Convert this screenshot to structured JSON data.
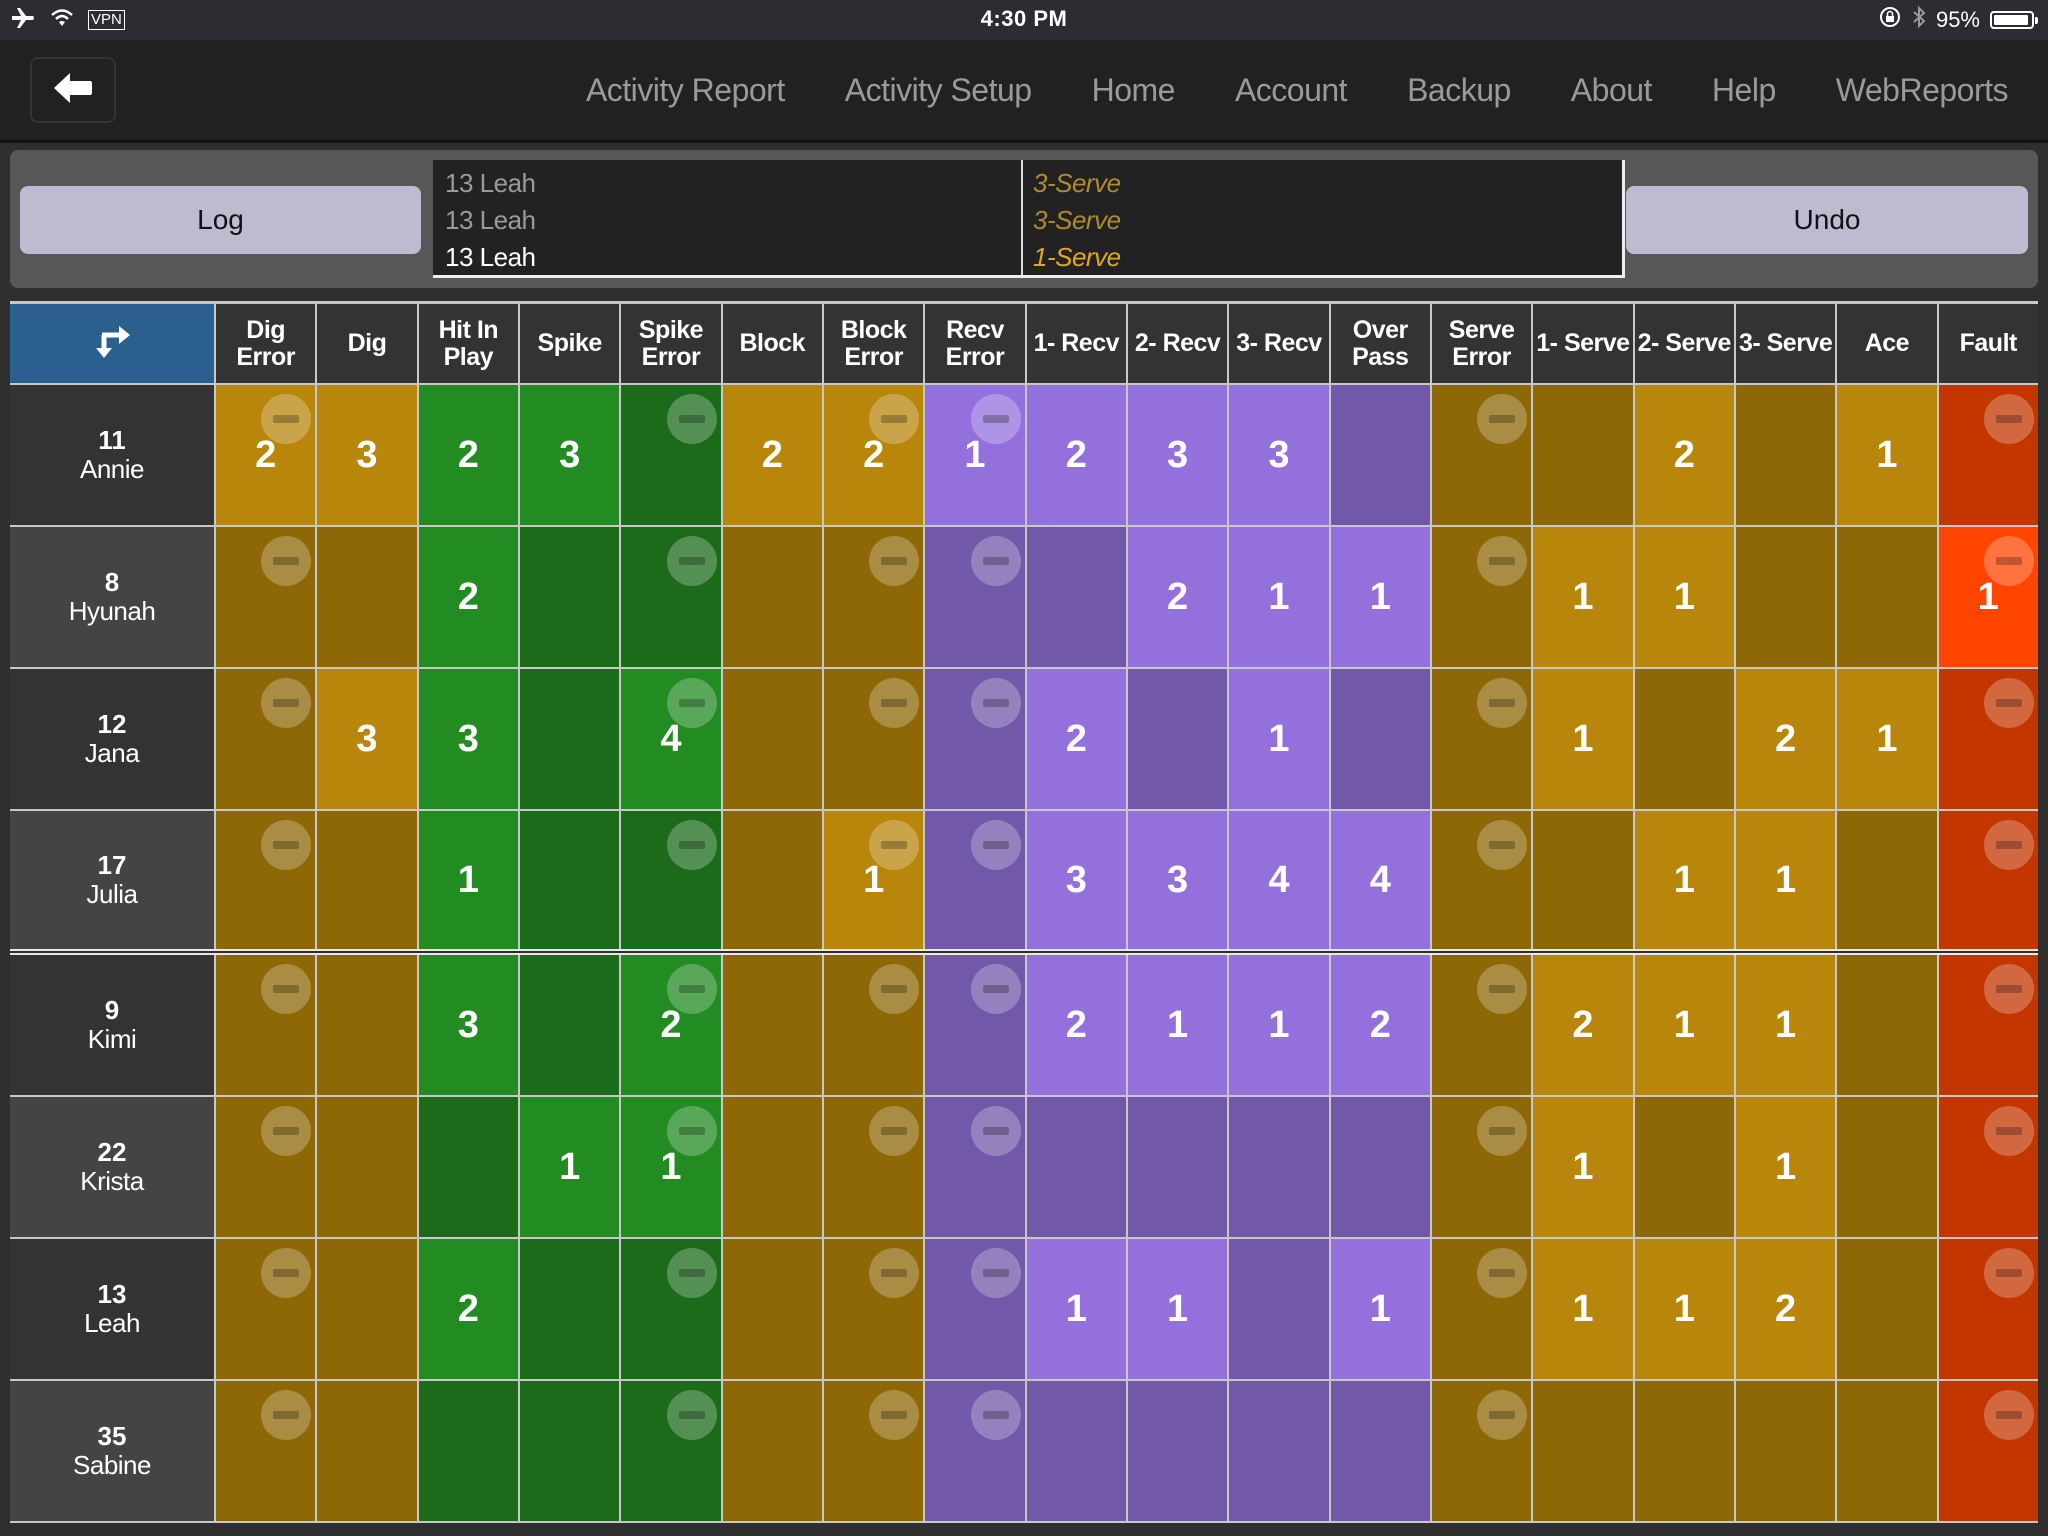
{
  "status_bar": {
    "time": "4:30 PM",
    "vpn_label": "VPN",
    "battery_percent_label": "95%",
    "battery_level": 0.95,
    "icons": [
      "airplane-icon",
      "wifi-icon",
      "vpn-icon",
      "rotation-lock-icon",
      "bluetooth-icon",
      "battery-icon"
    ]
  },
  "nav": {
    "back_icon": "arrow-left-icon",
    "items": [
      {
        "label": "Activity Report"
      },
      {
        "label": "Activity Setup"
      },
      {
        "label": "Home"
      },
      {
        "label": "Account"
      },
      {
        "label": "Backup"
      },
      {
        "label": "About"
      },
      {
        "label": "Help"
      },
      {
        "label": "WebReports"
      }
    ]
  },
  "log_panel": {
    "log_label": "Log",
    "undo_label": "Undo",
    "entries": [
      {
        "player": "13 Leah",
        "action": "3-Serve",
        "current": false
      },
      {
        "player": "13 Leah",
        "action": "3-Serve",
        "current": false
      },
      {
        "player": "13 Leah",
        "action": "1-Serve",
        "current": true
      }
    ]
  },
  "grid": {
    "corner_icon": "swap-arrows-icon",
    "columns": [
      {
        "label": "Dig Error",
        "group": "gold",
        "error": true
      },
      {
        "label": "Dig",
        "group": "gold",
        "error": false
      },
      {
        "label": "Hit In Play",
        "group": "green",
        "error": false
      },
      {
        "label": "Spike",
        "group": "green",
        "error": false
      },
      {
        "label": "Spike Error",
        "group": "green",
        "error": true
      },
      {
        "label": "Block",
        "group": "gold",
        "error": false
      },
      {
        "label": "Block Error",
        "group": "gold",
        "error": true
      },
      {
        "label": "Recv Error",
        "group": "purple",
        "error": true
      },
      {
        "label": "1- Recv",
        "group": "purple",
        "error": false
      },
      {
        "label": "2- Recv",
        "group": "purple",
        "error": false
      },
      {
        "label": "3- Recv",
        "group": "purple",
        "error": false
      },
      {
        "label": "Over Pass",
        "group": "purple",
        "error": false
      },
      {
        "label": "Serve Error",
        "group": "gold",
        "error": true
      },
      {
        "label": "1- Serve",
        "group": "gold",
        "error": false
      },
      {
        "label": "2- Serve",
        "group": "gold",
        "error": false
      },
      {
        "label": "3- Serve",
        "group": "gold",
        "error": false
      },
      {
        "label": "Ace",
        "group": "gold",
        "error": false
      },
      {
        "label": "Fault",
        "group": "red",
        "error": true
      }
    ],
    "colors": {
      "gold": {
        "active": "#b8860b",
        "dim": "#8e6706"
      },
      "green": {
        "active": "#228b22",
        "dim": "#1b6b1b"
      },
      "purple": {
        "active": "#9370db",
        "dim": "#7158a8"
      },
      "red": {
        "active": "#ff4500",
        "dim": "#c33600"
      },
      "header_corner": "#2a5f8f"
    },
    "rows": [
      {
        "number": "11",
        "name": "Annie",
        "values": [
          "2",
          "3",
          "2",
          "3",
          "",
          "2",
          "2",
          "1",
          "2",
          "3",
          "3",
          "",
          "",
          "",
          "2",
          "",
          "1",
          ""
        ]
      },
      {
        "number": "8",
        "name": "Hyunah",
        "values": [
          "",
          "",
          "2",
          "",
          "",
          "",
          "",
          "",
          "",
          "2",
          "1",
          "1",
          "",
          "1",
          "1",
          "",
          "",
          "1"
        ]
      },
      {
        "number": "12",
        "name": "Jana",
        "values": [
          "",
          "3",
          "3",
          "",
          "4",
          "",
          "",
          "",
          "2",
          "",
          "1",
          "",
          "",
          "1",
          "",
          "2",
          "1",
          ""
        ]
      },
      {
        "number": "17",
        "name": "Julia",
        "values": [
          "",
          "",
          "1",
          "",
          "",
          "",
          "1",
          "",
          "3",
          "3",
          "4",
          "4",
          "",
          "",
          "1",
          "1",
          "",
          ""
        ]
      },
      {
        "number": "9",
        "name": "Kimi",
        "values": [
          "",
          "",
          "3",
          "",
          "2",
          "",
          "",
          "",
          "2",
          "1",
          "1",
          "2",
          "",
          "2",
          "1",
          "1",
          "",
          ""
        ]
      },
      {
        "number": "22",
        "name": "Krista",
        "values": [
          "",
          "",
          "",
          "1",
          "1",
          "",
          "",
          "",
          "",
          "",
          "",
          "",
          "",
          "1",
          "",
          "1",
          "",
          ""
        ]
      },
      {
        "number": "13",
        "name": "Leah",
        "values": [
          "",
          "",
          "2",
          "",
          "",
          "",
          "",
          "",
          "1",
          "1",
          "",
          "1",
          "",
          "1",
          "1",
          "2",
          "",
          ""
        ]
      },
      {
        "number": "35",
        "name": "Sabine",
        "values": [
          "",
          "",
          "",
          "",
          "",
          "",
          "",
          "",
          "",
          "",
          "",
          "",
          "",
          "",
          "",
          "",
          "",
          ""
        ]
      }
    ]
  }
}
